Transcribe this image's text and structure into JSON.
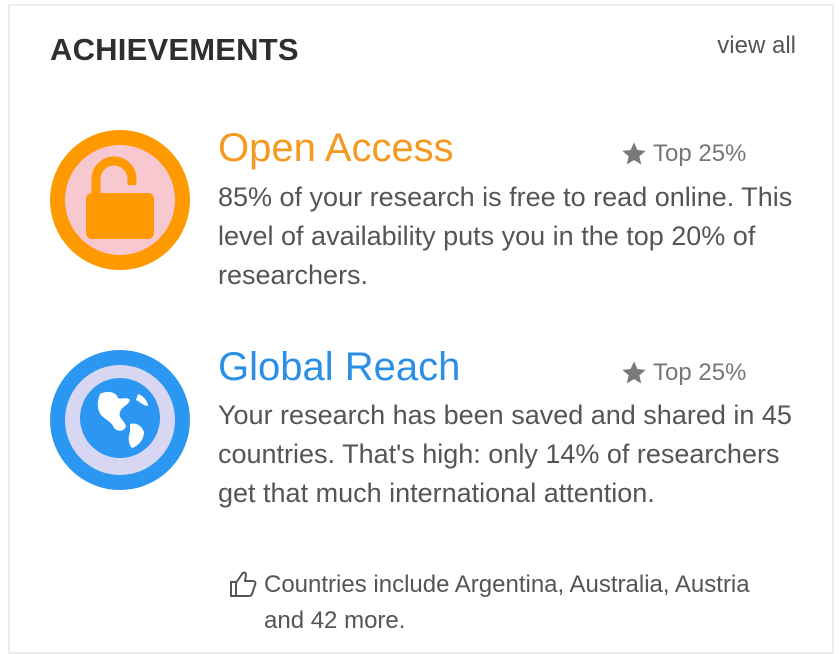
{
  "header": {
    "title": "ACHIEVEMENTS",
    "view_all": "view all"
  },
  "achievements": [
    {
      "title": "Open Access",
      "rank": "Top 25%",
      "description": "85% of your research is free to read online. This level of availability puts you in the top 20% of researchers.",
      "icon": "unlocked-padlock-icon",
      "color": "#f49a21",
      "ring_color": "#ff9900",
      "fill_color": "#f7c8cf"
    },
    {
      "title": "Global Reach",
      "rank": "Top 25%",
      "description": "Your research has been saved and shared in 45 countries. That's high: only 14% of researchers get that much international attention.",
      "icon": "globe-icon",
      "color": "#2b8fe6",
      "ring_color": "#2b97f2",
      "fill_color": "#d7d7f4",
      "note": "Countries include Argentina, Australia, Austria and 42 more.",
      "note_icon": "thumbs-up-icon"
    }
  ],
  "rank_icon": "star-icon"
}
